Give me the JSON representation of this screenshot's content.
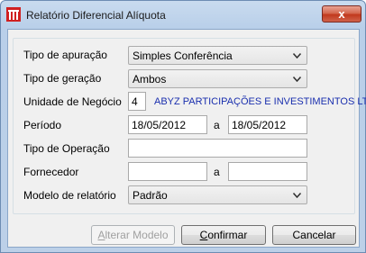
{
  "window": {
    "title": "Relatório Diferencial Alíquota",
    "close_glyph": "x"
  },
  "form": {
    "tipo_apuracao": {
      "label": "Tipo de apuração",
      "value": "Simples Conferência"
    },
    "tipo_geracao": {
      "label": "Tipo de geração",
      "value": "Ambos"
    },
    "unidade_negocio": {
      "label": "Unidade de Negócio",
      "code": "4",
      "name": "ABYZ PARTICIPAÇÕES E INVESTIMENTOS LTDA"
    },
    "periodo": {
      "label": "Período",
      "from": "18/05/2012",
      "separator": "a",
      "to": "18/05/2012"
    },
    "tipo_operacao": {
      "label": "Tipo de Operação",
      "value": ""
    },
    "fornecedor": {
      "label": "Fornecedor",
      "from": "",
      "separator": "a",
      "to": ""
    },
    "modelo_relatorio": {
      "label": "Modelo de relatório",
      "value": "Padrão"
    }
  },
  "buttons": {
    "alterar_modelo": {
      "mnemonic": "A",
      "rest": "lterar Modelo",
      "enabled": false
    },
    "confirmar": {
      "mnemonic": "C",
      "rest": "onfirmar"
    },
    "cancelar": {
      "mnemonic": "",
      "rest": "Cancelar"
    }
  },
  "colors": {
    "company_name": "#1a2fae",
    "title_bar": "#c9dbef",
    "close_button": "#c1391d"
  }
}
